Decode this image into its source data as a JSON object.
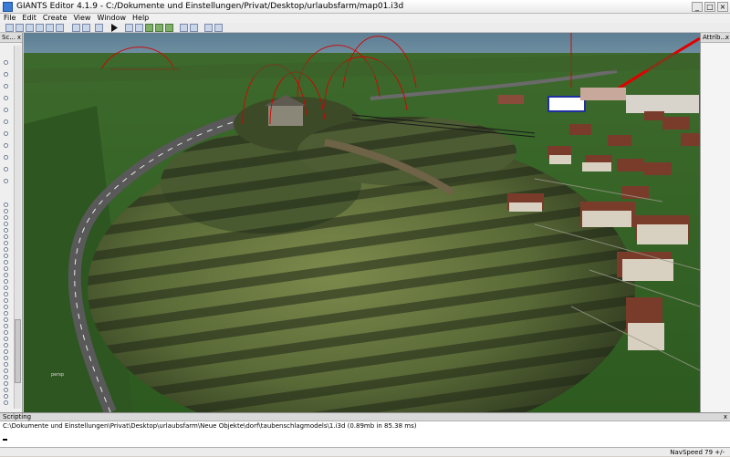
{
  "window": {
    "title": "GIANTS Editor 4.1.9 - C:/Dokumente und Einstellungen/Privat/Desktop/urlaubsfarm/map01.i3d"
  },
  "menu": {
    "items": [
      "File",
      "Edit",
      "Create",
      "View",
      "Window",
      "Help"
    ]
  },
  "toolbar": {
    "buttons": [
      "new-icon",
      "open-icon",
      "save-icon",
      "import-icon",
      "export-icon",
      "save-all-icon",
      "undo-icon",
      "redo-icon",
      "play-icon",
      "cursor-icon",
      "select-icon",
      "terrain-icon",
      "paint-icon",
      "foliage-icon",
      "vertex-icon",
      "tool-icon",
      "zoom-icon"
    ]
  },
  "left_panel": {
    "title": "Sc...",
    "close": "x"
  },
  "right_panel": {
    "title": "Attrib...",
    "close": "x"
  },
  "log": {
    "title": "Scripting",
    "close": "x",
    "lines": [
      "C:\\Dokumente und Einstellungen\\Privat\\Desktop\\urlaubsfarm\\Neue Objekte\\dorf\\taubenschlagmodels\\1.i3d (0.89mb in 85.38 ms)"
    ]
  },
  "viewport": {
    "corner_label": "persp"
  },
  "status": {
    "nav_speed": "NavSpeed 79 +/-"
  }
}
